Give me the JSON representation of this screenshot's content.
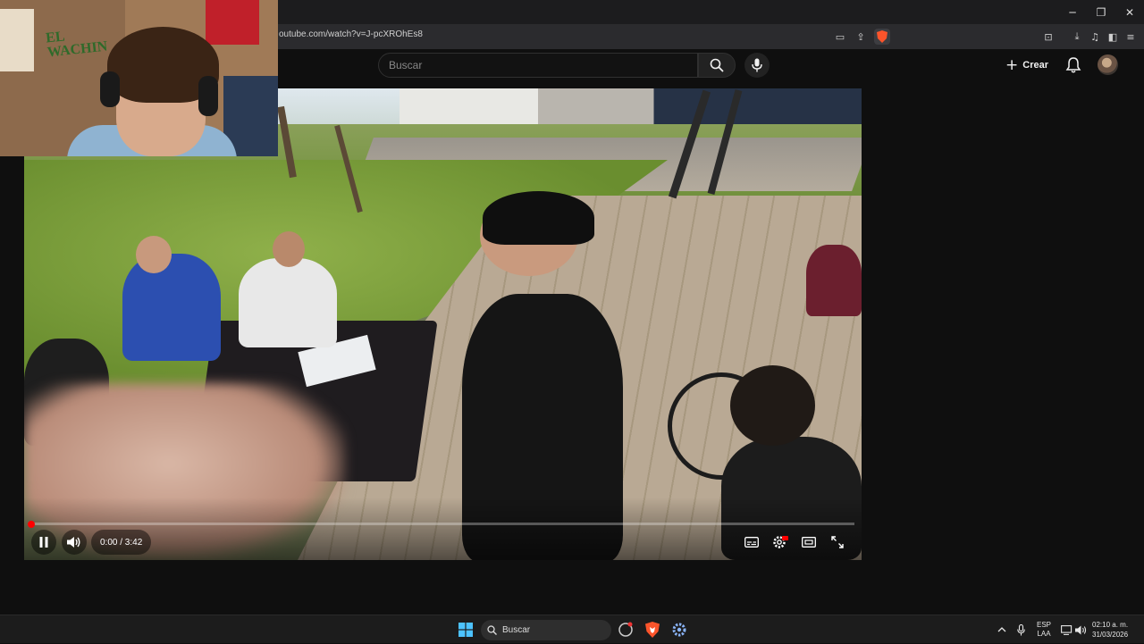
{
  "browser": {
    "url": "outube.com/watch?v=J-pcXROhEs8",
    "window_controls": [
      "minimize-icon",
      "restore-icon",
      "close-icon"
    ],
    "accent": "#ff2d55"
  },
  "youtube": {
    "search_placeholder": "Buscar",
    "create_label": "Crear",
    "icons": [
      "search-icon",
      "mic-icon",
      "plus-icon",
      "bell-icon"
    ]
  },
  "player": {
    "time_display": "0:00 / 3:42",
    "progress": 0.0,
    "state": "playing",
    "accent": "#ff0000"
  },
  "webcam": {
    "sign_line1": "EL",
    "sign_line2": "WACHIN"
  },
  "taskbar": {
    "search_label": "Buscar",
    "lang_line1": "ESP",
    "lang_line2": "LAA",
    "time": "02:10 a. m.",
    "date": "31/03/2026"
  }
}
